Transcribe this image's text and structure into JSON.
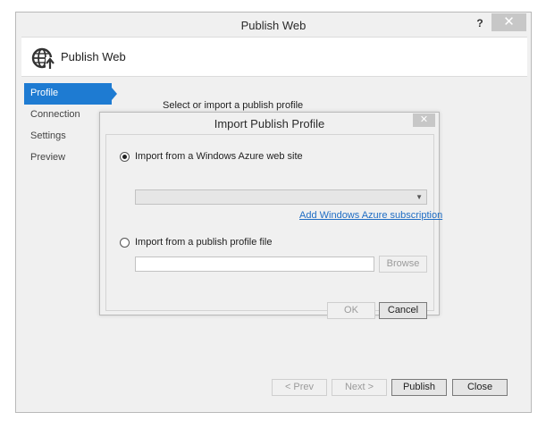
{
  "window": {
    "title": "Publish Web",
    "help_glyph": "?",
    "close_glyph": "✕"
  },
  "header": {
    "title": "Publish Web",
    "icon": "globe-publish-icon"
  },
  "nav": {
    "items": [
      {
        "label": "Profile",
        "active": true
      },
      {
        "label": "Connection",
        "active": false
      },
      {
        "label": "Settings",
        "active": false
      },
      {
        "label": "Preview",
        "active": false
      }
    ]
  },
  "profile": {
    "heading": "Select or import a publish profile"
  },
  "modal": {
    "title": "Import Publish Profile",
    "close_glyph": "✕",
    "option_azure": {
      "label": "Import from a Windows Azure web site",
      "checked": true
    },
    "azure_site_select": {
      "value": ""
    },
    "add_subscription_link": "Add Windows Azure subscription",
    "option_file": {
      "label": "Import from a publish profile file",
      "checked": false
    },
    "file_path": {
      "value": ""
    },
    "browse_label": "Browse",
    "ok_label": "OK",
    "cancel_label": "Cancel"
  },
  "footer": {
    "prev_label": "< Prev",
    "next_label": "Next >",
    "publish_label": "Publish",
    "close_label": "Close"
  },
  "colors": {
    "accent": "#1e7bd2",
    "link": "#1f6dc4",
    "close_button": "#c7c7c7"
  }
}
